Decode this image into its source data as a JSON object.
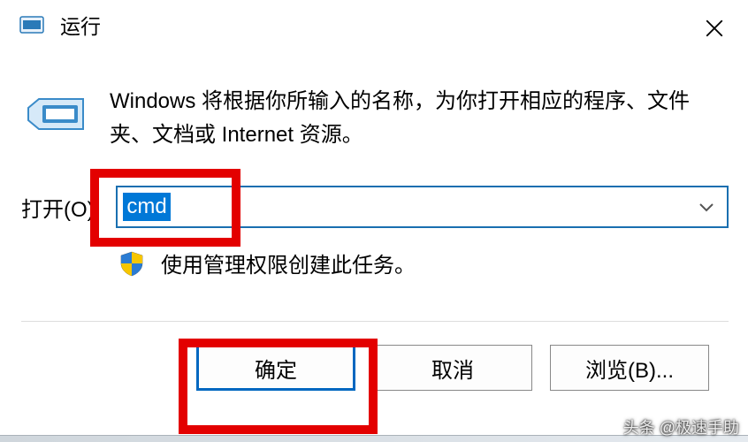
{
  "title": "运行",
  "description": "Windows 将根据你所输入的名称，为你打开相应的程序、文件夹、文档或 Internet 资源。",
  "open_label": "打开(O):",
  "input_value": "cmd",
  "admin_note": "使用管理权限创建此任务。",
  "buttons": {
    "ok": "确定",
    "cancel": "取消",
    "browse": "浏览(B)..."
  },
  "watermark": "头条 @极速手助"
}
